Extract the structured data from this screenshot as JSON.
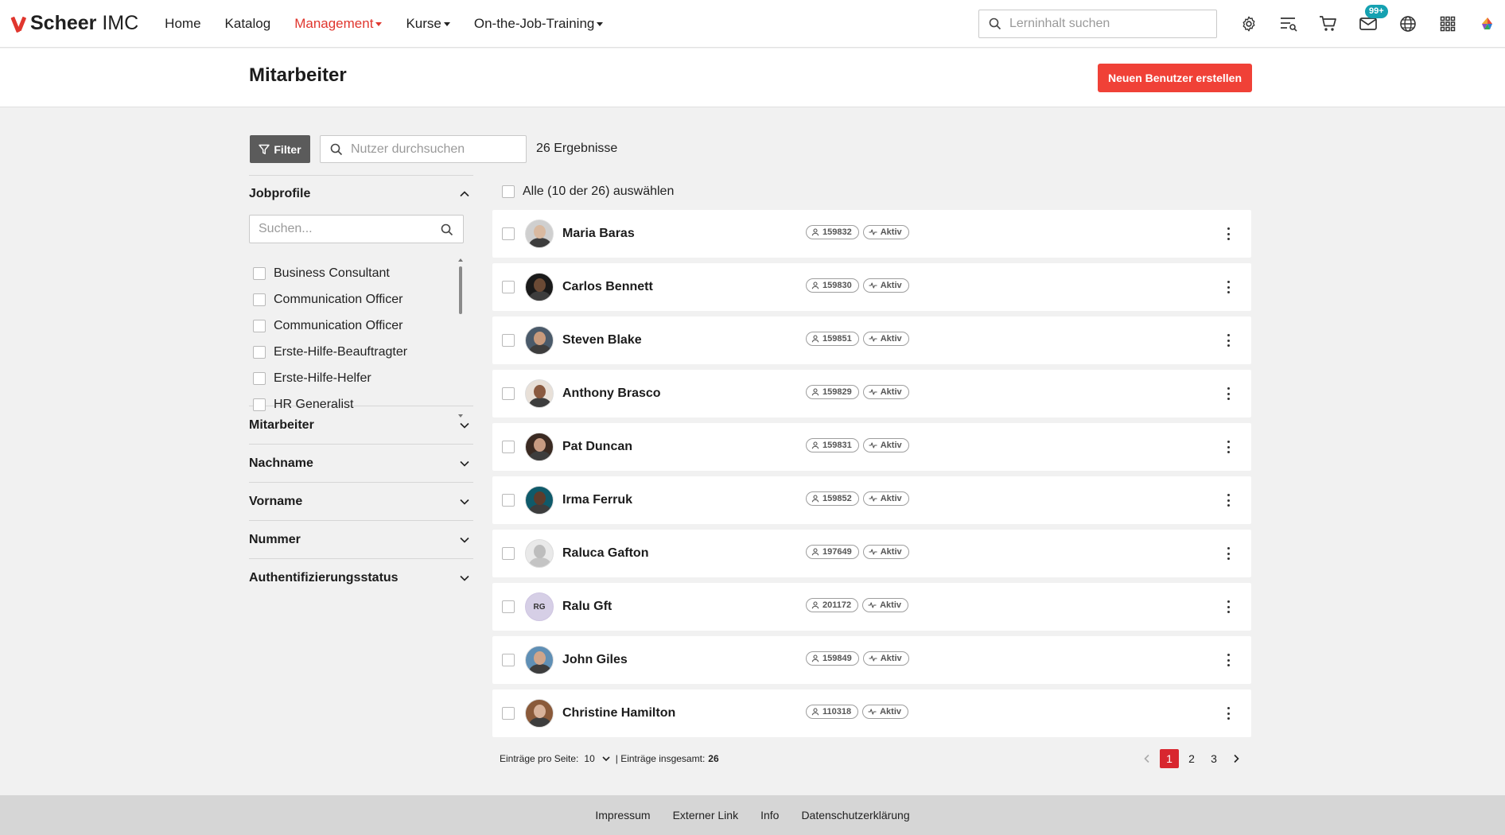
{
  "app": {
    "logo_brand": "Scheer",
    "logo_suffix": " IMC",
    "brand_color": "#e0362e"
  },
  "nav": {
    "items": [
      {
        "label": "Home",
        "dropdown": false,
        "active": false
      },
      {
        "label": "Katalog",
        "dropdown": false,
        "active": false
      },
      {
        "label": "Management",
        "dropdown": true,
        "active": true
      },
      {
        "label": "Kurse",
        "dropdown": true,
        "active": false
      },
      {
        "label": "On-the-Job-Training",
        "dropdown": true,
        "active": false
      }
    ],
    "search_placeholder": "Lerninhalt suchen",
    "icons": [
      "gear-icon",
      "list-search-icon",
      "cart-icon",
      "mail-icon",
      "globe-icon",
      "apps-grid-icon",
      "color-logo-icon"
    ],
    "mail_badge": "99+"
  },
  "header": {
    "title": "Mitarbeiter",
    "create_button": "Neuen Benutzer erstellen"
  },
  "toolbar": {
    "filter_label": "Filter",
    "search_placeholder": "Nutzer durchsuchen",
    "results": "26 Ergebnisse"
  },
  "sidebar": {
    "jobprofile": {
      "title": "Jobprofile",
      "search_placeholder": "Suchen...",
      "options": [
        "Business Consultant",
        "Communication Officer",
        "Communication Officer",
        "Erste-Hilfe-Beauftragter",
        "Erste-Hilfe-Helfer",
        "HR Generalist"
      ]
    },
    "facets": [
      "Mitarbeiter",
      "Nachname",
      "Vorname",
      "Nummer",
      "Authentifizierungsstatus"
    ]
  },
  "list": {
    "select_all": "Alle (10 der 26) auswählen",
    "users": [
      {
        "name": "Maria Baras",
        "id": "159832",
        "status": "Aktiv",
        "avatar": "photo",
        "skin": "#d9b9a0",
        "hair": "#cfcfcf"
      },
      {
        "name": "Carlos Bennett",
        "id": "159830",
        "status": "Aktiv",
        "avatar": "photo",
        "skin": "#6b4a35",
        "hair": "#1a1a1a"
      },
      {
        "name": "Steven Blake",
        "id": "159851",
        "status": "Aktiv",
        "avatar": "photo",
        "skin": "#c89a7c",
        "hair": "#4a5a6a"
      },
      {
        "name": "Anthony Brasco",
        "id": "159829",
        "status": "Aktiv",
        "avatar": "photo",
        "skin": "#8a5a40",
        "hair": "#e8e0d8"
      },
      {
        "name": "Pat Duncan",
        "id": "159831",
        "status": "Aktiv",
        "avatar": "photo",
        "skin": "#c79b82",
        "hair": "#3a2a22"
      },
      {
        "name": "Irma Ferruk",
        "id": "159852",
        "status": "Aktiv",
        "avatar": "photo",
        "skin": "#5e3c2c",
        "hair": "#0f5a6a"
      },
      {
        "name": "Raluca Gafton",
        "id": "197649",
        "status": "Aktiv",
        "avatar": "placeholder",
        "skin": "#bdbdbd",
        "hair": "#e9e9e9"
      },
      {
        "name": "Ralu Gft",
        "id": "201172",
        "status": "Aktiv",
        "avatar": "initials",
        "initials": "RG"
      },
      {
        "name": "John Giles",
        "id": "159849",
        "status": "Aktiv",
        "avatar": "photo",
        "skin": "#d0a58a",
        "hair": "#5f8fb5"
      },
      {
        "name": "Christine Hamilton",
        "id": "110318",
        "status": "Aktiv",
        "avatar": "photo",
        "skin": "#d8b29a",
        "hair": "#8a5a3a"
      }
    ]
  },
  "pagination": {
    "per_page_label": "Einträge pro Seite:",
    "per_page_value": "10",
    "total_label": "| Einträge insgesamt:",
    "total_value": "26",
    "pages": [
      "1",
      "2",
      "3"
    ],
    "current": "1"
  },
  "footer": {
    "links": [
      "Impressum",
      "Externer Link",
      "Info",
      "Datenschutzerklärung"
    ]
  }
}
